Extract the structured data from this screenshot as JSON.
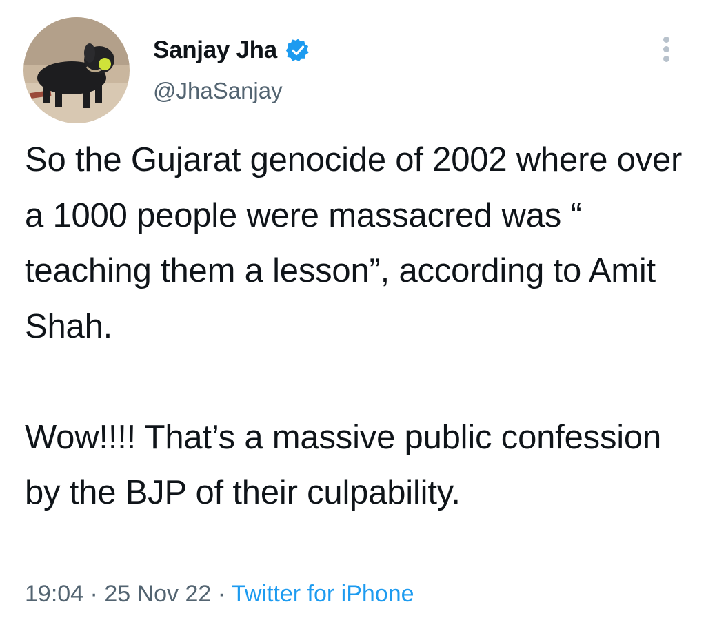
{
  "author": {
    "display_name": "Sanjay Jha",
    "handle": "@JhaSanjay",
    "verified": true,
    "avatar": "dog-with-tennis-ball-avatar"
  },
  "tweet": {
    "paragraph_1": "So the Gujarat genocide of 2002 where over a 1000 people were massacred was “ teaching them a lesson”, according to Amit Shah.",
    "paragraph_2": "Wow!!!! That’s a massive public confession by the BJP of their culpability."
  },
  "meta": {
    "time": "19:04",
    "separator": "·",
    "date": "25 Nov 22",
    "source": "Twitter for iPhone"
  },
  "colors": {
    "text": "#0f1419",
    "secondary": "#536471",
    "accent": "#1d9bf0"
  },
  "icons": {
    "verified": "verified-badge-icon",
    "more": "more-options-icon"
  }
}
